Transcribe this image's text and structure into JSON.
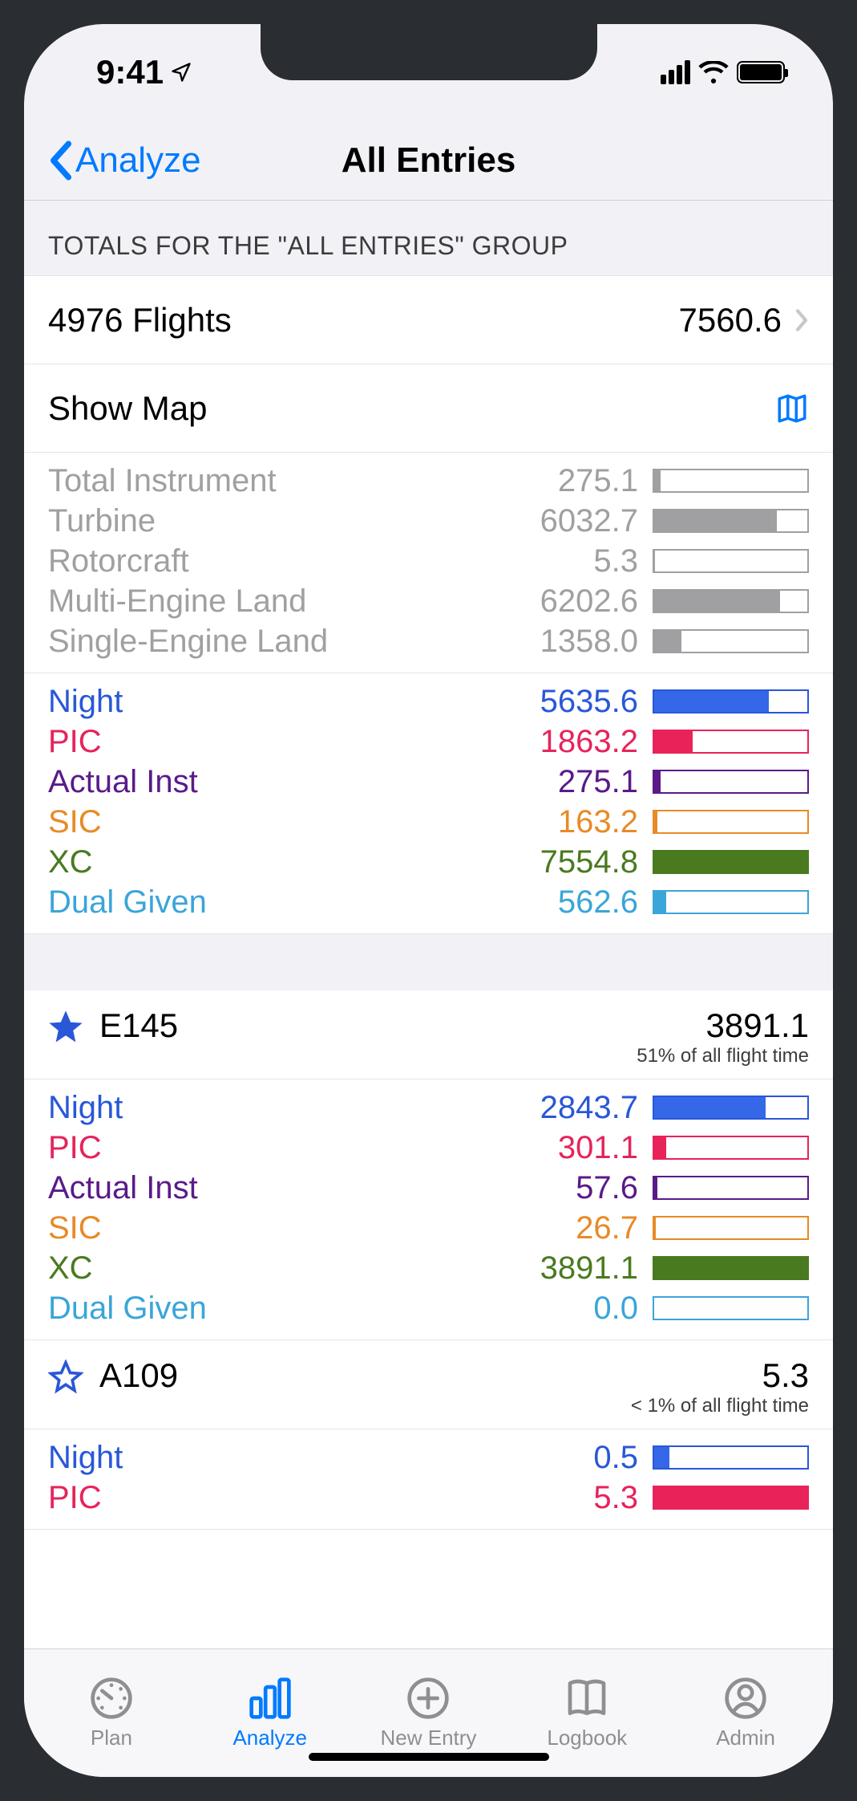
{
  "status": {
    "time": "9:41"
  },
  "nav": {
    "back": "Analyze",
    "title": "All Entries"
  },
  "section_header": "TOTALS FOR THE \"ALL ENTRIES\" GROUP",
  "totals": {
    "flights_label": "4976 Flights",
    "total_value": "7560.6",
    "show_map": "Show Map"
  },
  "gray_stats": [
    {
      "label": "Total Instrument",
      "value": "275.1",
      "pct": 4
    },
    {
      "label": "Turbine",
      "value": "6032.7",
      "pct": 80
    },
    {
      "label": "Rotorcraft",
      "value": "5.3",
      "pct": 0.5
    },
    {
      "label": "Multi-Engine Land",
      "value": "6202.6",
      "pct": 82
    },
    {
      "label": "Single-Engine Land",
      "value": "1358.0",
      "pct": 18
    }
  ],
  "color_stats": [
    {
      "label": "Night",
      "value": "5635.6",
      "pct": 75,
      "class": "c-blue"
    },
    {
      "label": "PIC",
      "value": "1863.2",
      "pct": 25,
      "class": "c-red"
    },
    {
      "label": "Actual Inst",
      "value": "275.1",
      "pct": 4,
      "class": "c-purple"
    },
    {
      "label": "SIC",
      "value": "163.2",
      "pct": 2,
      "class": "c-orange"
    },
    {
      "label": "XC",
      "value": "7554.8",
      "pct": 100,
      "class": "c-green"
    },
    {
      "label": "Dual Given",
      "value": "562.6",
      "pct": 8,
      "class": "c-sky"
    }
  ],
  "aircraft": [
    {
      "name": "E145",
      "value": "3891.1",
      "sub": "51% of all flight time",
      "starred": true,
      "stats": [
        {
          "label": "Night",
          "value": "2843.7",
          "pct": 73,
          "class": "c-blue"
        },
        {
          "label": "PIC",
          "value": "301.1",
          "pct": 8,
          "class": "c-red"
        },
        {
          "label": "Actual Inst",
          "value": "57.6",
          "pct": 2,
          "class": "c-purple"
        },
        {
          "label": "SIC",
          "value": "26.7",
          "pct": 1,
          "class": "c-orange"
        },
        {
          "label": "XC",
          "value": "3891.1",
          "pct": 100,
          "class": "c-green"
        },
        {
          "label": "Dual Given",
          "value": "0.0",
          "pct": 0,
          "class": "c-sky"
        }
      ]
    },
    {
      "name": "A109",
      "value": "5.3",
      "sub": "< 1% of all flight time",
      "starred": false,
      "stats": [
        {
          "label": "Night",
          "value": "0.5",
          "pct": 10,
          "class": "c-blue"
        },
        {
          "label": "PIC",
          "value": "5.3",
          "pct": 100,
          "class": "c-red"
        }
      ]
    }
  ],
  "tabs": [
    {
      "label": "Plan",
      "active": false
    },
    {
      "label": "Analyze",
      "active": true
    },
    {
      "label": "New Entry",
      "active": false
    },
    {
      "label": "Logbook",
      "active": false
    },
    {
      "label": "Admin",
      "active": false
    }
  ]
}
